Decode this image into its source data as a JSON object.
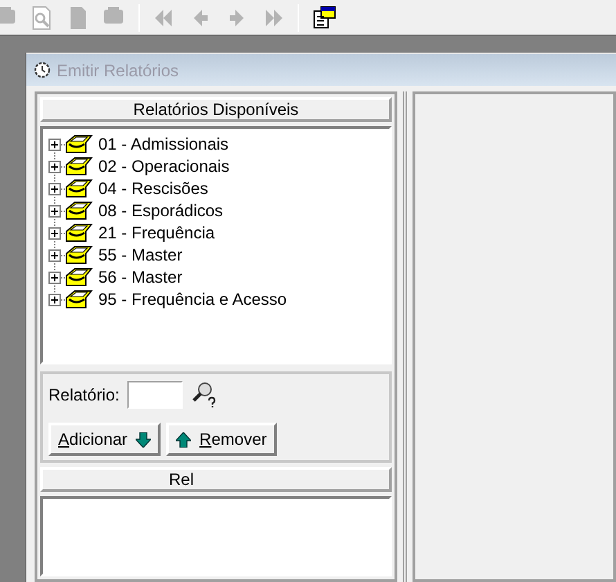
{
  "toolbar": {
    "buttons": [
      {
        "kind": "printer",
        "disabled": true
      },
      {
        "kind": "preview",
        "disabled": true
      },
      {
        "kind": "pages",
        "disabled": true
      },
      {
        "kind": "printer",
        "disabled": true
      },
      {
        "kind": "separator"
      },
      {
        "kind": "first",
        "disabled": true
      },
      {
        "kind": "prev",
        "disabled": true
      },
      {
        "kind": "next",
        "disabled": true
      },
      {
        "kind": "last",
        "disabled": true
      },
      {
        "kind": "separator"
      },
      {
        "kind": "form"
      }
    ]
  },
  "window": {
    "title": "Emitir Relatórios"
  },
  "available": {
    "header": "Relatórios Disponíveis",
    "items": [
      {
        "label": "01 - Admissionais",
        "expanded": false
      },
      {
        "label": "02 - Operacionais",
        "expanded": false
      },
      {
        "label": "04 - Rescisões",
        "expanded": false
      },
      {
        "label": "08 - Esporádicos",
        "expanded": false
      },
      {
        "label": "21 - Frequência",
        "expanded": false
      },
      {
        "label": "55 - Master",
        "expanded": false
      },
      {
        "label": "56 - Master",
        "expanded": false
      },
      {
        "label": "95 - Frequência e Acesso",
        "expanded": false
      }
    ]
  },
  "report_field": {
    "label": "Relatório:"
  },
  "buttons": [
    {
      "kind": "add",
      "label": "Adicionar"
    },
    {
      "kind": "remove",
      "label": "Remover"
    }
  ],
  "selected_list": {
    "header": "Rel"
  }
}
